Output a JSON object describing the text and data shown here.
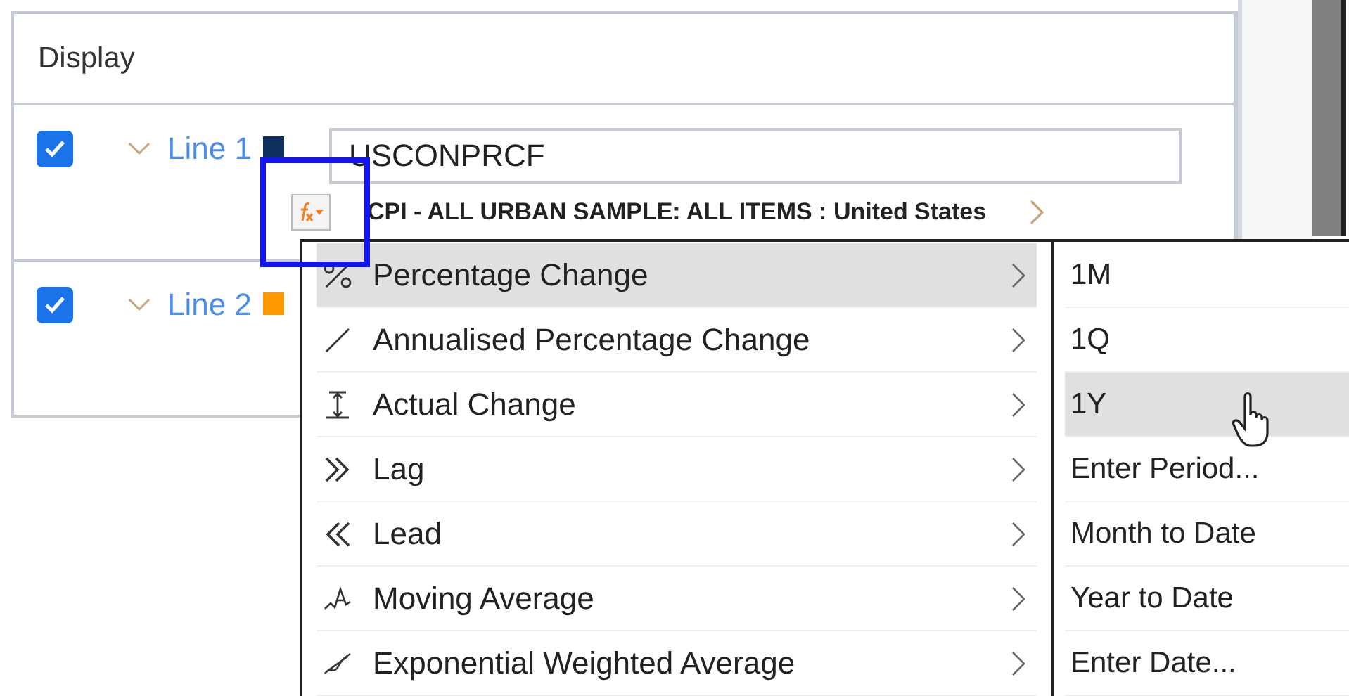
{
  "panel": {
    "title": "Display",
    "lines": [
      {
        "label": "Line 1",
        "checked": true,
        "expanded": true,
        "color": "#0d2f5e",
        "code": "USCONPRCF",
        "description": "CPI - ALL URBAN SAMPLE: ALL ITEMS : United States"
      },
      {
        "label": "Line 2",
        "checked": true,
        "expanded": true,
        "color": "#ff9900"
      }
    ]
  },
  "menu": {
    "items": [
      {
        "kind": "percent",
        "label": "Percentage Change",
        "selected": true
      },
      {
        "kind": "slash",
        "label": "Annualised Percentage Change",
        "selected": false
      },
      {
        "kind": "change",
        "label": "Actual Change",
        "selected": false
      },
      {
        "kind": "lag",
        "label": "Lag",
        "selected": false
      },
      {
        "kind": "lead",
        "label": "Lead",
        "selected": false
      },
      {
        "kind": "moving",
        "label": "Moving Average",
        "selected": false
      },
      {
        "kind": "weighted",
        "label": "Exponential Weighted Average",
        "selected": false
      }
    ]
  },
  "submenu": {
    "items": [
      {
        "label": "1M",
        "selected": false
      },
      {
        "label": "1Q",
        "selected": false
      },
      {
        "label": "1Y",
        "selected": true
      },
      {
        "label": "Enter Period...",
        "selected": false
      },
      {
        "label": "Month to Date",
        "selected": false
      },
      {
        "label": "Year to Date",
        "selected": false
      },
      {
        "label": "Enter Date...",
        "selected": false
      }
    ]
  }
}
